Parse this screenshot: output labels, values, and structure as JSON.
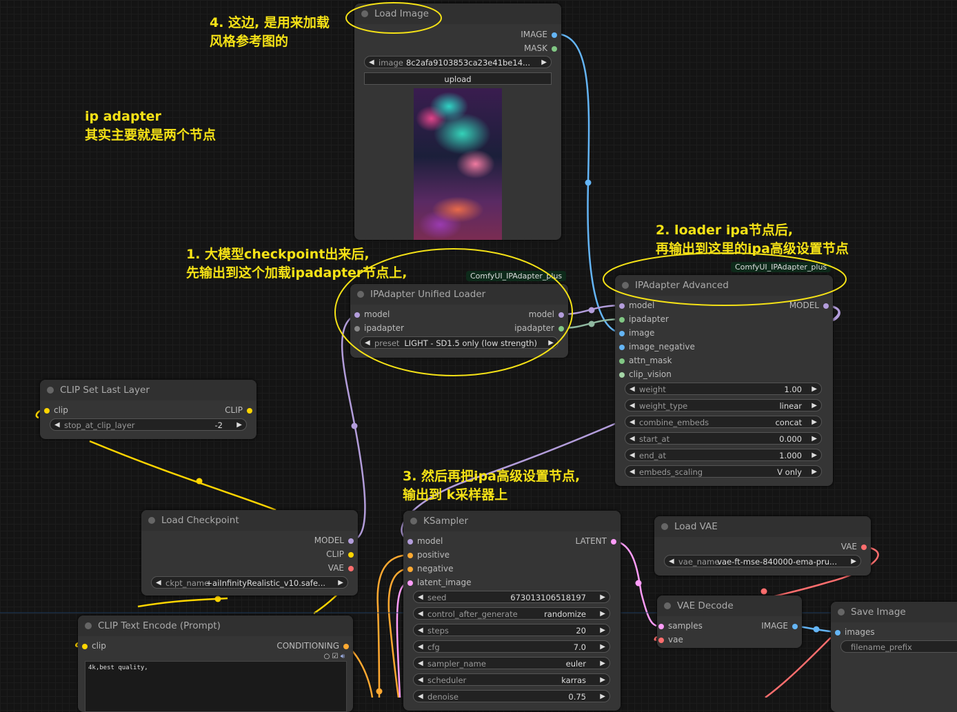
{
  "notes": {
    "n4_line1": "4. 这边, 是用来加载",
    "n4_line2": "风格参考图的",
    "ip_line1": "ip adapter",
    "ip_line2": "其实主要就是两个节点",
    "n1_line1": "1. 大模型checkpoint出来后,",
    "n1_line2": "先输出到这个加载ipadapter节点上,",
    "n2_line1": "2. loader ipa节点后,",
    "n2_line2": "再输出到这里的ipa高级设置节点",
    "n3_line1": "3. 然后再把ipa高级设置节点,",
    "n3_line2": "输出到 k采样器上"
  },
  "load_image": {
    "title": "Load Image",
    "out_image": "IMAGE",
    "out_mask": "MASK",
    "image_label": "image",
    "image_value": "8c2afa9103853ca23e41be14...",
    "upload": "upload"
  },
  "ipa_loader": {
    "badge": "ComfyUI_IPAdapter_plus",
    "title": "IPAdapter Unified Loader",
    "in_model": "model",
    "in_ipadapter": "ipadapter",
    "out_model": "model",
    "out_ipadapter": "ipadapter",
    "preset_label": "preset",
    "preset_value": "LIGHT - SD1.5 only (low strength)"
  },
  "ipa_adv": {
    "badge": "ComfyUI_IPAdapter_plus",
    "title": "IPAdapter Advanced",
    "inputs": [
      "model",
      "ipadapter",
      "image",
      "image_negative",
      "attn_mask",
      "clip_vision"
    ],
    "out_model": "MODEL",
    "widgets": [
      {
        "label": "weight",
        "value": "1.00"
      },
      {
        "label": "weight_type",
        "value": "linear"
      },
      {
        "label": "combine_embeds",
        "value": "concat"
      },
      {
        "label": "start_at",
        "value": "0.000"
      },
      {
        "label": "end_at",
        "value": "1.000"
      },
      {
        "label": "embeds_scaling",
        "value": "V only"
      }
    ]
  },
  "clip_last": {
    "title": "CLIP Set Last Layer",
    "in_clip": "clip",
    "out_clip": "CLIP",
    "w_label": "stop_at_clip_layer",
    "w_value": "-2"
  },
  "load_ckpt": {
    "title": "Load Checkpoint",
    "out_model": "MODEL",
    "out_clip": "CLIP",
    "out_vae": "VAE",
    "w_label": "ckpt_name",
    "w_value": "+aiInfinityRealistic_v10.safe..."
  },
  "ksampler": {
    "title": "KSampler",
    "inputs": [
      "model",
      "positive",
      "negative",
      "latent_image"
    ],
    "out_latent": "LATENT",
    "widgets": [
      {
        "label": "seed",
        "value": "673013106518197"
      },
      {
        "label": "control_after_generate",
        "value": "randomize"
      },
      {
        "label": "steps",
        "value": "20"
      },
      {
        "label": "cfg",
        "value": "7.0"
      },
      {
        "label": "sampler_name",
        "value": "euler"
      },
      {
        "label": "scheduler",
        "value": "karras"
      },
      {
        "label": "denoise",
        "value": "0.75"
      }
    ]
  },
  "load_vae": {
    "title": "Load VAE",
    "out_vae": "VAE",
    "w_label": "vae_name",
    "w_value": "vae-ft-mse-840000-ema-pru..."
  },
  "vae_decode": {
    "title": "VAE Decode",
    "in_samples": "samples",
    "in_vae": "vae",
    "out_image": "IMAGE"
  },
  "save_image": {
    "title": "Save Image",
    "in_images": "images",
    "w_label": "filename_prefix"
  },
  "clip_text": {
    "title": "CLIP Text Encode (Prompt)",
    "in_clip": "clip",
    "out_cond": "CONDITIONING",
    "text": "4k,best quality,"
  },
  "colors": {
    "model": "#b39ddb",
    "clip": "#ffd500",
    "vae": "#ff6e6e",
    "image": "#64b5f6",
    "mask": "#81c784",
    "latent": "#ff9cf9",
    "conditioning": "#ffa931",
    "ipadapter": "#81c784",
    "note": "#f5e216"
  }
}
